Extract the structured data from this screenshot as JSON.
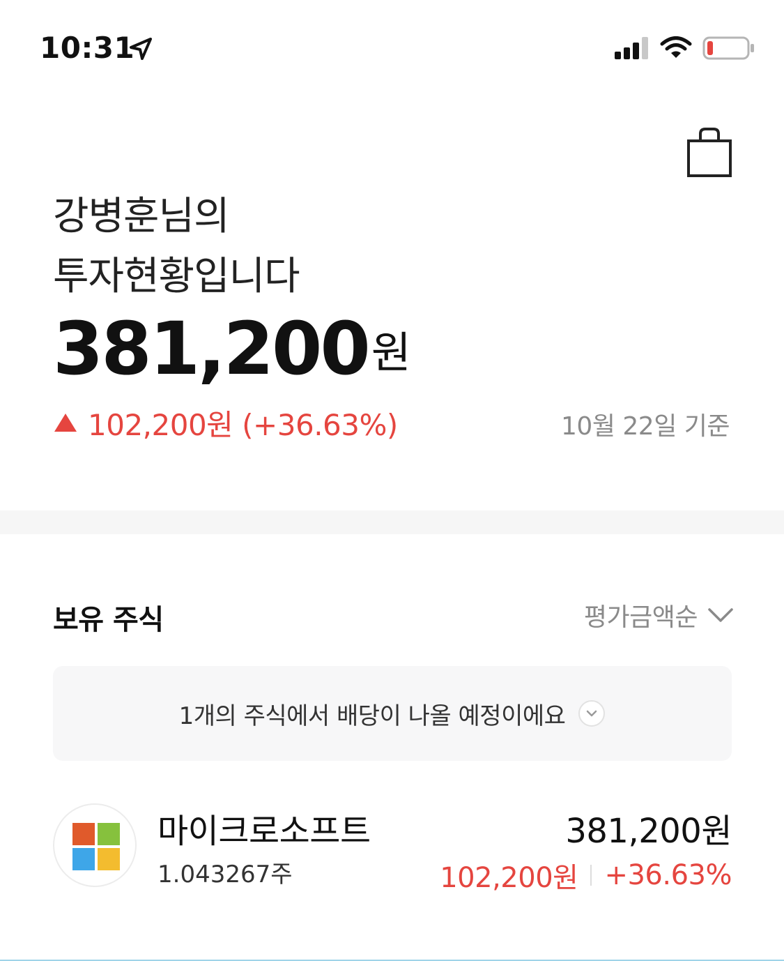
{
  "status_bar": {
    "time": "10:31",
    "icons": [
      "location-arrow-icon",
      "signal-icon",
      "wifi-icon",
      "battery-icon"
    ],
    "battery_color": "#e5453f"
  },
  "header": {
    "icon": "shopping-bag-icon"
  },
  "summary": {
    "greeting_line1": "강병훈님의",
    "greeting_line2": "투자현황입니다",
    "total_value": "381,200",
    "total_unit": "원",
    "change_text": "102,200원 (+36.63%)",
    "as_of": "10월 22일 기준",
    "up_color": "#e5453f"
  },
  "holdings": {
    "title": "보유 주식",
    "sort_label": "평가금액순",
    "dividend_banner": "1개의 주식에서 배당이 나올 예정이에요",
    "stocks": [
      {
        "name": "마이크로소프트",
        "quantity": "1.043267주",
        "value": "381,200원",
        "profit": "102,200원",
        "rate": "+36.63%",
        "logo": "microsoft-logo"
      }
    ]
  }
}
